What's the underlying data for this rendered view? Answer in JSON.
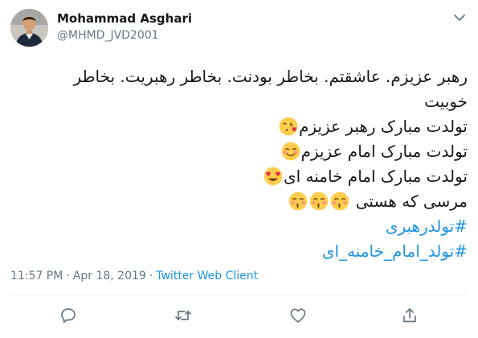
{
  "user": {
    "display_name": "Mohammad Asghari",
    "handle": "@MHMD_JVD2001"
  },
  "tweet": {
    "lines": [
      "رهبر عزیزم. عاشقتم. بخاطر بودنت. بخاطر رهبریت. بخاطر",
      "خوبیت",
      "تولدت مبارک رهبر عزیزم",
      "تولدت مبارک امام عزیزم",
      "تولدت مبارک امام خامنه ای",
      "مرسی که هستی"
    ],
    "hashtags": [
      "#تولدرهبری",
      "#تولد_امام_خامنه_ای"
    ],
    "emojis": {
      "line3": "face-blowing-kiss",
      "line4": "smiling-face-with-smiling-eyes",
      "line5": "smiling-face-with-heart-eyes",
      "line6": [
        "kissing-face-with-smiling-eyes",
        "kissing-face-with-smiling-eyes",
        "kissing-face-with-smiling-eyes"
      ]
    }
  },
  "meta": {
    "time": "11:57 PM",
    "separator1": "·",
    "date": "Apr 18, 2019",
    "separator2": "·",
    "client": "Twitter Web Client"
  },
  "actions": [
    "reply-icon",
    "retweet-icon",
    "like-icon",
    "share-icon"
  ],
  "colors": {
    "text": "#14171a",
    "secondary": "#657786",
    "link": "#1b95e0",
    "divider": "#e6ecf0",
    "emoji_face": "#ffcc4d",
    "emoji_heart": "#dd2e44"
  }
}
